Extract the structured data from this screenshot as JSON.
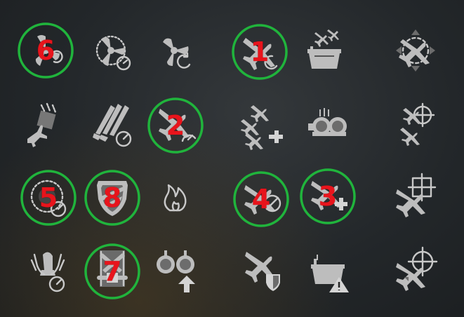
{
  "colors": {
    "ring": "#20b43c",
    "marker_number": "#e8141c",
    "icon": "#bdbdbd",
    "background": "#23272a"
  },
  "skills": [
    {
      "icon": "propeller-reload-icon",
      "marker": "6"
    },
    {
      "icon": "propeller-speed-icon",
      "marker": ""
    },
    {
      "icon": "propeller-restore-icon",
      "marker": ""
    },
    {
      "icon": "plane-cooldown-icon",
      "marker": "1"
    },
    {
      "icon": "carrier-squadron-icon",
      "marker": ""
    },
    {
      "icon": "plane-evade-icon",
      "marker": ""
    },
    {
      "icon": "plane-bomb-drop-icon",
      "marker": ""
    },
    {
      "icon": "rockets-speed-icon",
      "marker": ""
    },
    {
      "icon": "plane-speed-icon",
      "marker": "2"
    },
    {
      "icon": "squadron-heal-icon",
      "marker": ""
    },
    {
      "icon": "aa-guns-icon",
      "marker": ""
    },
    {
      "icon": "squadron-target-icon",
      "marker": ""
    },
    {
      "icon": "aa-range-icon",
      "marker": "5"
    },
    {
      "icon": "shield-armor-icon",
      "marker": "8"
    },
    {
      "icon": "fire-icon",
      "marker": ""
    },
    {
      "icon": "plane-reload-icon",
      "marker": "4"
    },
    {
      "icon": "plane-heal-icon",
      "marker": "3"
    },
    {
      "icon": "plane-aim-icon",
      "marker": ""
    },
    {
      "icon": "bomb-speed-icon",
      "marker": ""
    },
    {
      "icon": "torpedo-armor-icon",
      "marker": "7"
    },
    {
      "icon": "gauges-upgrade-icon",
      "marker": ""
    },
    {
      "icon": "plane-shield-icon",
      "marker": ""
    },
    {
      "icon": "carrier-warning-icon",
      "marker": ""
    },
    {
      "icon": "plane-crosshair-icon",
      "marker": ""
    }
  ]
}
